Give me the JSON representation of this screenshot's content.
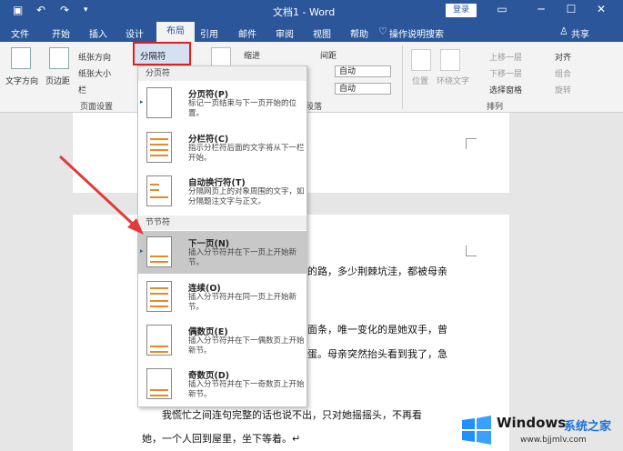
{
  "titlebar": {
    "title": "文档1 - Word",
    "login": "登录"
  },
  "tabs": [
    "文件",
    "开始",
    "插入",
    "设计",
    "布局",
    "引用",
    "邮件",
    "审阅",
    "视图",
    "帮助"
  ],
  "active_tab": "布局",
  "tell_me": "操作说明搜索",
  "share": "共享",
  "ribbon": {
    "text_direction": "文字方向",
    "margins": "页边距",
    "orientation": "纸张方向",
    "size": "纸张大小",
    "columns": "栏",
    "breaks": "分隔符",
    "page_setup_group": "页面设置",
    "indent": "缩进",
    "spacing": "间距",
    "auto1": "自动",
    "auto2": "自动",
    "paragraph_group": "段落",
    "position": "位置",
    "wrap_text": "环绕文字",
    "bring_forward": "上移一层",
    "send_backward": "下移一层",
    "selection_pane": "选择窗格",
    "align": "对齐",
    "group": "组合",
    "rotate": "旋转",
    "arrange_group": "排列"
  },
  "menu": {
    "page_breaks_header": "分页符",
    "section_breaks_header": "节节符",
    "items": [
      {
        "title": "分页符(P)",
        "desc": "标记一页结束与下一页开始的位置。"
      },
      {
        "title": "分栏符(C)",
        "desc": "指示分栏符后面的文字将从下一栏开始。"
      },
      {
        "title": "自动换行符(T)",
        "desc": "分隔网页上的对象周围的文字，如分隔题注文字与正文。"
      },
      {
        "title": "下一页(N)",
        "desc": "插入分节符并在下一页上开始新节。"
      },
      {
        "title": "连续(O)",
        "desc": "插入分节符并在同一页上开始新节。"
      },
      {
        "title": "偶数页(E)",
        "desc": "插入分节符并在下一偶数页上开始新节。"
      },
      {
        "title": "奇数页(D)",
        "desc": "插入分节符并在下一奇数页上开始新节。"
      }
    ]
  },
  "document": {
    "line1": "的路，多少荆棘坑洼，都被母亲",
    "line2": "面条，唯一变化的是她双手，曾",
    "line3": "蛋。母亲突然抬头看到我了，急",
    "line4": "我慌忙之间连句完整的话也说不出，只对她摇摇头，不再看",
    "line5": "她，一个人回到屋里，坐下等着。↵"
  },
  "watermark": {
    "brand": "Windows",
    "suffix": "系统之家",
    "url": "www.bjjmlv.com"
  },
  "colors": {
    "titlebar": "#2b579a",
    "highlight_border": "#e02020",
    "arrow": "#e23b3b"
  }
}
